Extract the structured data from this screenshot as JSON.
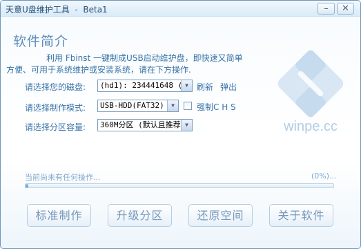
{
  "window": {
    "title": "天意U盘维护工具  -  Beta1",
    "minimize_icon": "minimize-icon",
    "close_icon": "close-icon"
  },
  "heading": "软件简介",
  "intro": {
    "line1": "利用 Fbinst 一键制成USB启动维护盘，即快速又简单",
    "line2": "方便、可用于系统维护或安装系统，请在下方操作."
  },
  "disk": {
    "label": "请选择您的磁盘:",
    "value": "(hd1): 234441648 (1",
    "refresh": "刷新",
    "eject": "弹出"
  },
  "mode": {
    "label": "请选择制作模式:",
    "value": "USB-HDD(FAT32)",
    "force_chs": "强制C H S"
  },
  "partition": {
    "label": "请选择分区容量:",
    "value": "360M分区 (默认且推荐"
  },
  "logo": {
    "text": "winpe.cc",
    "icon": "winpe-logo-icon"
  },
  "status": {
    "text": "当前尚未有任何操作...",
    "percent_text": "(0%)...",
    "progress": 0.01
  },
  "buttons": {
    "standard": "标准制作",
    "upgrade": "升级分区",
    "restore": "还原空间",
    "about": "关于软件"
  }
}
